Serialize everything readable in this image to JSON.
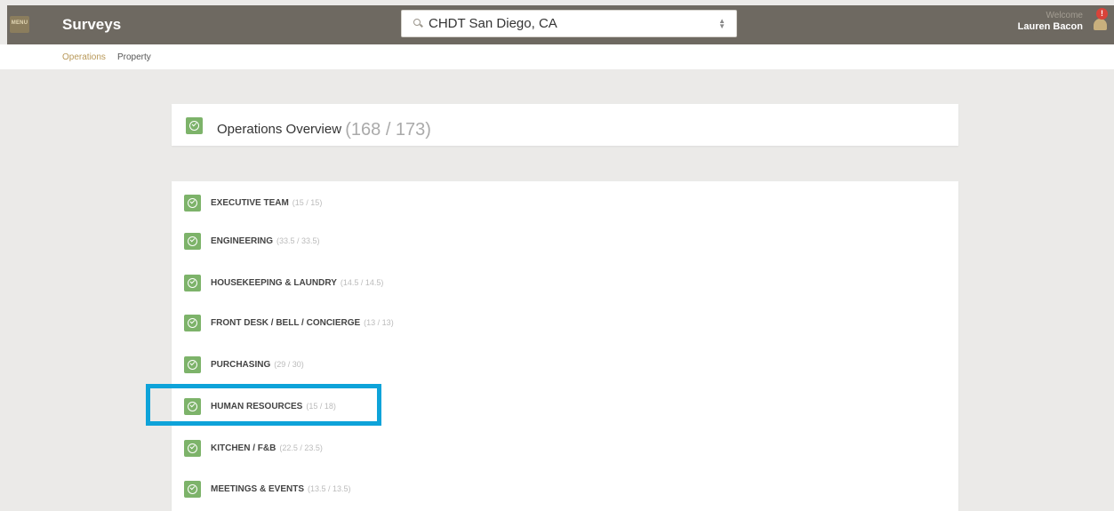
{
  "header": {
    "menu_label": "MENU",
    "app_title": "Surveys",
    "property_select_value": "CHDT San Diego, CA",
    "welcome_label": "Welcome",
    "user_name": "Lauren Bacon",
    "notification_badge": "!"
  },
  "subnav": {
    "tabs": [
      "Operations",
      "Property"
    ]
  },
  "overview": {
    "title": "Operations Overview",
    "count": "(168 / 173)"
  },
  "departments": [
    {
      "name": "EXECUTIVE TEAM",
      "score": "(15 / 15)"
    },
    {
      "name": "ENGINEERING",
      "score": "(33.5 / 33.5)"
    },
    {
      "name": "HOUSEKEEPING & LAUNDRY",
      "score": "(14.5 / 14.5)"
    },
    {
      "name": "FRONT DESK / BELL / CONCIERGE",
      "score": "(13 / 13)"
    },
    {
      "name": "PURCHASING",
      "score": "(29 / 30)"
    },
    {
      "name": "HUMAN RESOURCES",
      "score": "(15 / 18)"
    },
    {
      "name": "KITCHEN / F&B",
      "score": "(22.5 / 23.5)"
    },
    {
      "name": "MEETINGS & EVENTS",
      "score": "(13.5 / 13.5)"
    }
  ],
  "colors": {
    "header_bg": "#6e6961",
    "accent": "#b89858",
    "check_green": "#7db36a",
    "highlight_blue": "#0ea3d9"
  }
}
